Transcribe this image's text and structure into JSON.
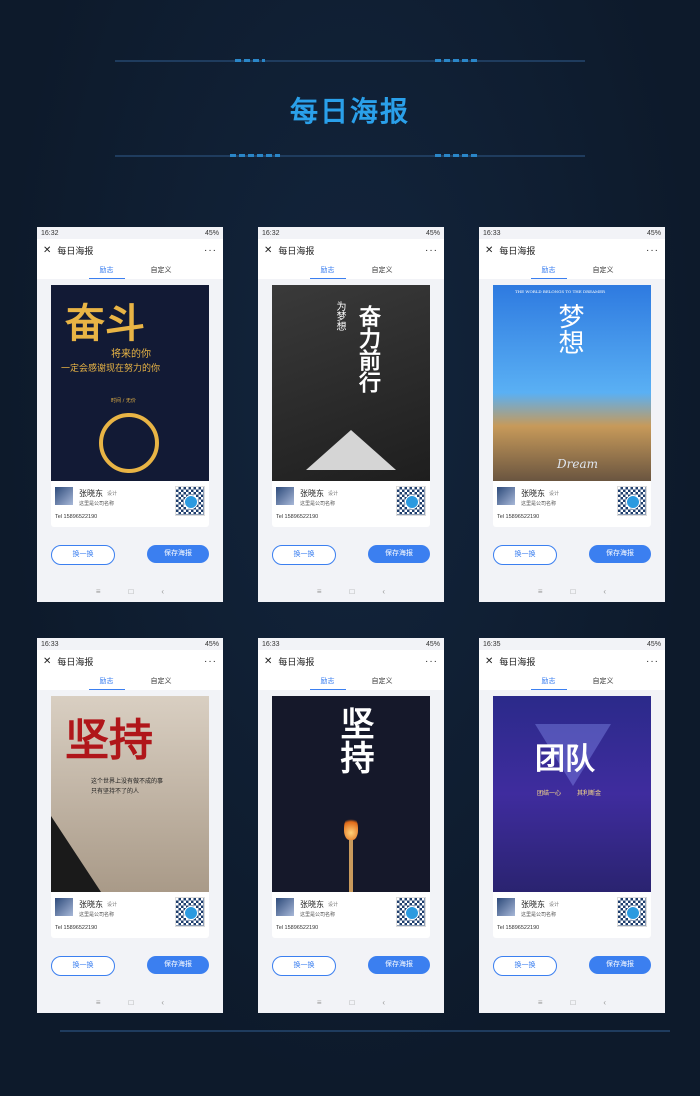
{
  "page_title": "每日海报",
  "phones": [
    {
      "time": "16:32",
      "battery": "45%",
      "app_title": "每日海报",
      "tabs": [
        "励志",
        "自定义"
      ],
      "poster": {
        "main": "奋斗",
        "sub1": "将来的你",
        "sub2": "一定会感谢现在努力的你",
        "caption": "时间 / 无价"
      },
      "user": {
        "name": "张晓东",
        "role": "设计",
        "company": "这里是公司名称",
        "tel": "Tel 15896522190"
      },
      "btn_swap": "换一换",
      "btn_save": "保存海报"
    },
    {
      "time": "16:32",
      "battery": "45%",
      "app_title": "每日海报",
      "tabs": [
        "励志",
        "自定义"
      ],
      "poster": {
        "main": "奋力前行",
        "sub1": "为梦想"
      },
      "user": {
        "name": "张晓东",
        "role": "设计",
        "company": "这里是公司名称",
        "tel": "Tel 15896522190"
      },
      "btn_swap": "换一换",
      "btn_save": "保存海报"
    },
    {
      "time": "16:33",
      "battery": "45%",
      "app_title": "每日海报",
      "tabs": [
        "励志",
        "自定义"
      ],
      "poster": {
        "main": "梦想",
        "sub1": "THE WORLD BELONGS TO THE DREAMER",
        "sub2": "Dream"
      },
      "user": {
        "name": "张晓东",
        "role": "设计",
        "company": "这里是公司名称",
        "tel": "Tel 15896522190"
      },
      "btn_swap": "换一换",
      "btn_save": "保存海报"
    },
    {
      "time": "16:33",
      "battery": "45%",
      "app_title": "每日海报",
      "tabs": [
        "励志",
        "自定义"
      ],
      "poster": {
        "main": "坚持",
        "sub1": "这个世界上没有做不成的事",
        "sub2": "只有坚持不了的人"
      },
      "user": {
        "name": "张晓东",
        "role": "设计",
        "company": "这里是公司名称",
        "tel": "Tel 15896522190"
      },
      "btn_swap": "换一换",
      "btn_save": "保存海报"
    },
    {
      "time": "16:33",
      "battery": "45%",
      "app_title": "每日海报",
      "tabs": [
        "励志",
        "自定义"
      ],
      "poster": {
        "main": "坚持"
      },
      "user": {
        "name": "张晓东",
        "role": "设计",
        "company": "这里是公司名称",
        "tel": "Tel 15896522190"
      },
      "btn_swap": "换一换",
      "btn_save": "保存海报"
    },
    {
      "time": "16:35",
      "battery": "45%",
      "app_title": "每日海报",
      "tabs": [
        "励志",
        "自定义"
      ],
      "poster": {
        "main": "团队",
        "sub1": "团结一心",
        "sub2": "其利断金"
      },
      "user": {
        "name": "张晓东",
        "role": "设计",
        "company": "这里是公司名称",
        "tel": "Tel 15896522190"
      },
      "btn_swap": "换一换",
      "btn_save": "保存海报"
    }
  ],
  "nav_icons": [
    "menu-icon",
    "home-square-icon",
    "back-chevron-icon"
  ],
  "colors": {
    "accent": "#3b7ff0",
    "title": "#2aa0ea",
    "background": "#0f1d30"
  }
}
